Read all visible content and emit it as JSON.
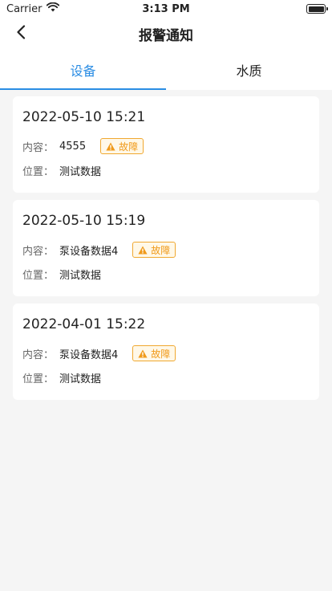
{
  "status_bar": {
    "carrier": "Carrier",
    "time": "3:13 PM"
  },
  "header": {
    "title": "报警通知"
  },
  "tabs": [
    {
      "label": "设备",
      "active": true
    },
    {
      "label": "水质",
      "active": false
    }
  ],
  "labels": {
    "content": "内容：",
    "location": "位置："
  },
  "alarms": [
    {
      "time": "2022-05-10 15:21",
      "content": "4555",
      "status": "故障",
      "location": "测试数据"
    },
    {
      "time": "2022-05-10 15:19",
      "content": "泵设备数据4",
      "status": "故障",
      "location": "测试数据"
    },
    {
      "time": "2022-04-01 15:22",
      "content": "泵设备数据4",
      "status": "故障",
      "location": "测试数据"
    }
  ],
  "colors": {
    "accent": "#2b8de4",
    "warning": "#f09a1a",
    "background": "#f5f5f5"
  }
}
